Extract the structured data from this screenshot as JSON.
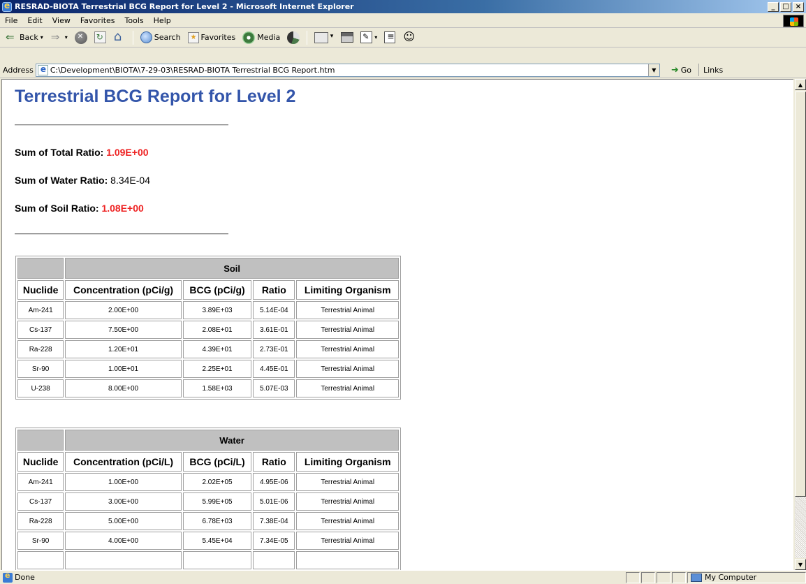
{
  "window": {
    "title": "RESRAD-BIOTA Terrestrial BCG Report for Level 2 - Microsoft Internet Explorer",
    "min": "_",
    "max": "□",
    "close": "×"
  },
  "menu": {
    "file": "File",
    "edit": "Edit",
    "view": "View",
    "favorites": "Favorites",
    "tools": "Tools",
    "help": "Help"
  },
  "toolbar": {
    "back": "Back",
    "search": "Search",
    "favorites": "Favorites",
    "media": "Media"
  },
  "address": {
    "label": "Address",
    "url": "C:\\Development\\BIOTA\\7-29-03\\RESRAD-BIOTA Terrestrial BCG Report.htm",
    "go": "Go",
    "links": "Links"
  },
  "report": {
    "title": "Terrestrial BCG Report for Level 2",
    "sums": [
      {
        "label": "Sum of Total Ratio:",
        "value": "1.09E+00",
        "highlight": true
      },
      {
        "label": "Sum of Water Ratio:",
        "value": "8.34E-04",
        "highlight": false
      },
      {
        "label": "Sum of Soil Ratio:",
        "value": "1.08E+00",
        "highlight": true
      }
    ],
    "soil": {
      "group": "Soil",
      "headers": [
        "Nuclide",
        "Concentration (pCi/g)",
        "BCG (pCi/g)",
        "Ratio",
        "Limiting Organism"
      ],
      "rows": [
        [
          "Am-241",
          "2.00E+00",
          "3.89E+03",
          "5.14E-04",
          "Terrestrial Animal"
        ],
        [
          "Cs-137",
          "7.50E+00",
          "2.08E+01",
          "3.61E-01",
          "Terrestrial Animal"
        ],
        [
          "Ra-228",
          "1.20E+01",
          "4.39E+01",
          "2.73E-01",
          "Terrestrial Animal"
        ],
        [
          "Sr-90",
          "1.00E+01",
          "2.25E+01",
          "4.45E-01",
          "Terrestrial Animal"
        ],
        [
          "U-238",
          "8.00E+00",
          "1.58E+03",
          "5.07E-03",
          "Terrestrial Animal"
        ]
      ]
    },
    "water": {
      "group": "Water",
      "headers": [
        "Nuclide",
        "Concentration (pCi/L)",
        "BCG (pCi/L)",
        "Ratio",
        "Limiting Organism"
      ],
      "rows": [
        [
          "Am-241",
          "1.00E+00",
          "2.02E+05",
          "4.95E-06",
          "Terrestrial Animal"
        ],
        [
          "Cs-137",
          "3.00E+00",
          "5.99E+05",
          "5.01E-06",
          "Terrestrial Animal"
        ],
        [
          "Ra-228",
          "5.00E+00",
          "6.78E+03",
          "7.38E-04",
          "Terrestrial Animal"
        ],
        [
          "Sr-90",
          "4.00E+00",
          "5.45E+04",
          "7.34E-05",
          "Terrestrial Animal"
        ],
        [
          "",
          "",
          "",
          "",
          ""
        ]
      ]
    }
  },
  "status": {
    "text": "Done",
    "zone": "My Computer"
  },
  "colors": {
    "title_blue": "#3355aa",
    "alert_red": "#ee2222",
    "header_gray": "#c0c0c0"
  }
}
